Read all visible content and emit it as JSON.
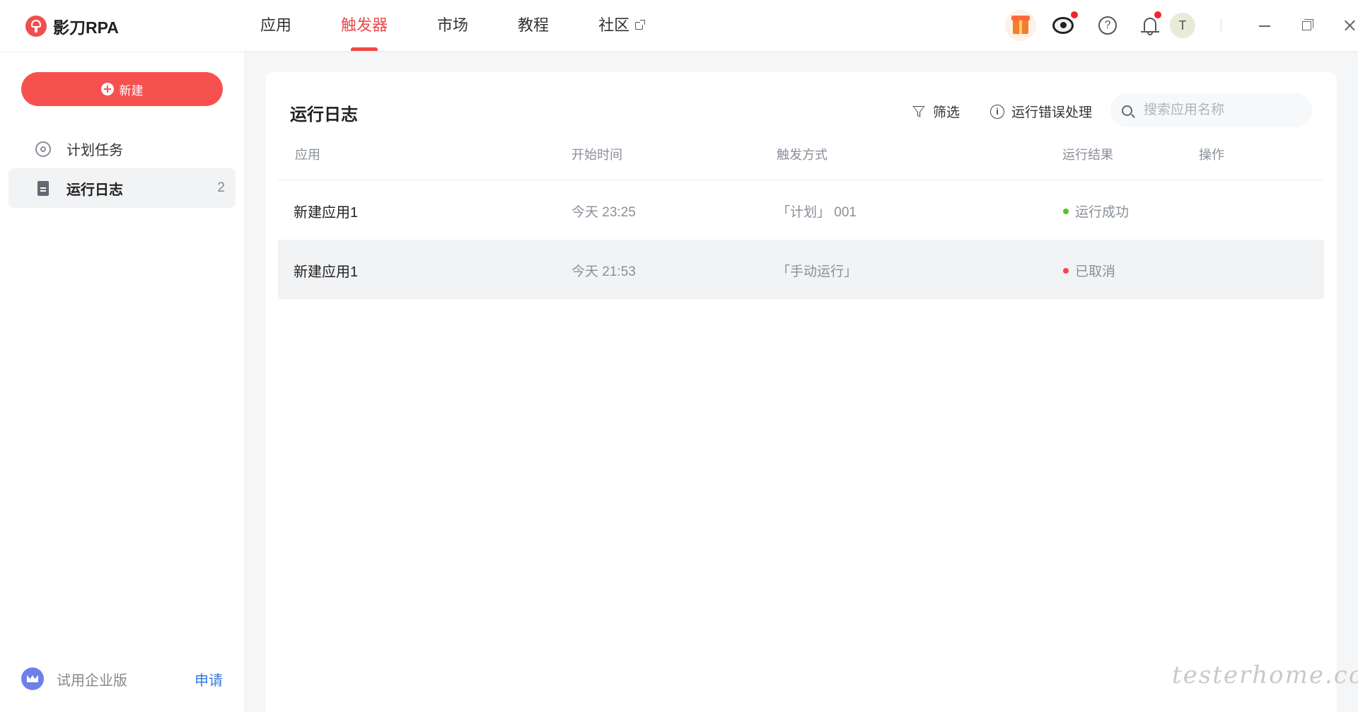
{
  "app": {
    "brand": "影刀RPA"
  },
  "nav": [
    {
      "label": "应用",
      "active": false
    },
    {
      "label": "触发器",
      "active": true
    },
    {
      "label": "市场",
      "active": false
    },
    {
      "label": "教程",
      "active": false
    },
    {
      "label": "社区",
      "active": false,
      "external": true
    }
  ],
  "header": {
    "avatar_initial": "T"
  },
  "sidebar": {
    "new_button": "新建",
    "items": [
      {
        "label": "计划任务",
        "icon": "clock-icon",
        "count": ""
      },
      {
        "label": "运行日志",
        "icon": "document-icon",
        "count": "2",
        "active": true
      }
    ],
    "trial_label": "试用企业版",
    "trial_link": "申请"
  },
  "main": {
    "title": "运行日志",
    "filter_label": "筛选",
    "error_label": "运行错误处理",
    "search_placeholder": "搜索应用名称",
    "columns": [
      "应用",
      "开始时间",
      "触发方式",
      "运行结果",
      "操作"
    ],
    "rows": [
      {
        "app": "新建应用1",
        "time": "今天 23:25",
        "trigger": "「计划」 001",
        "result": "运行成功",
        "status_color": "#52c41a"
      },
      {
        "app": "新建应用1",
        "time": "今天 21:53",
        "trigger": "「手动运行」",
        "result": "已取消",
        "status_color": "#f5474b"
      }
    ]
  },
  "colors": {
    "accent": "#f04848",
    "link": "#2f7ae5"
  },
  "watermark": "testerhome.com"
}
